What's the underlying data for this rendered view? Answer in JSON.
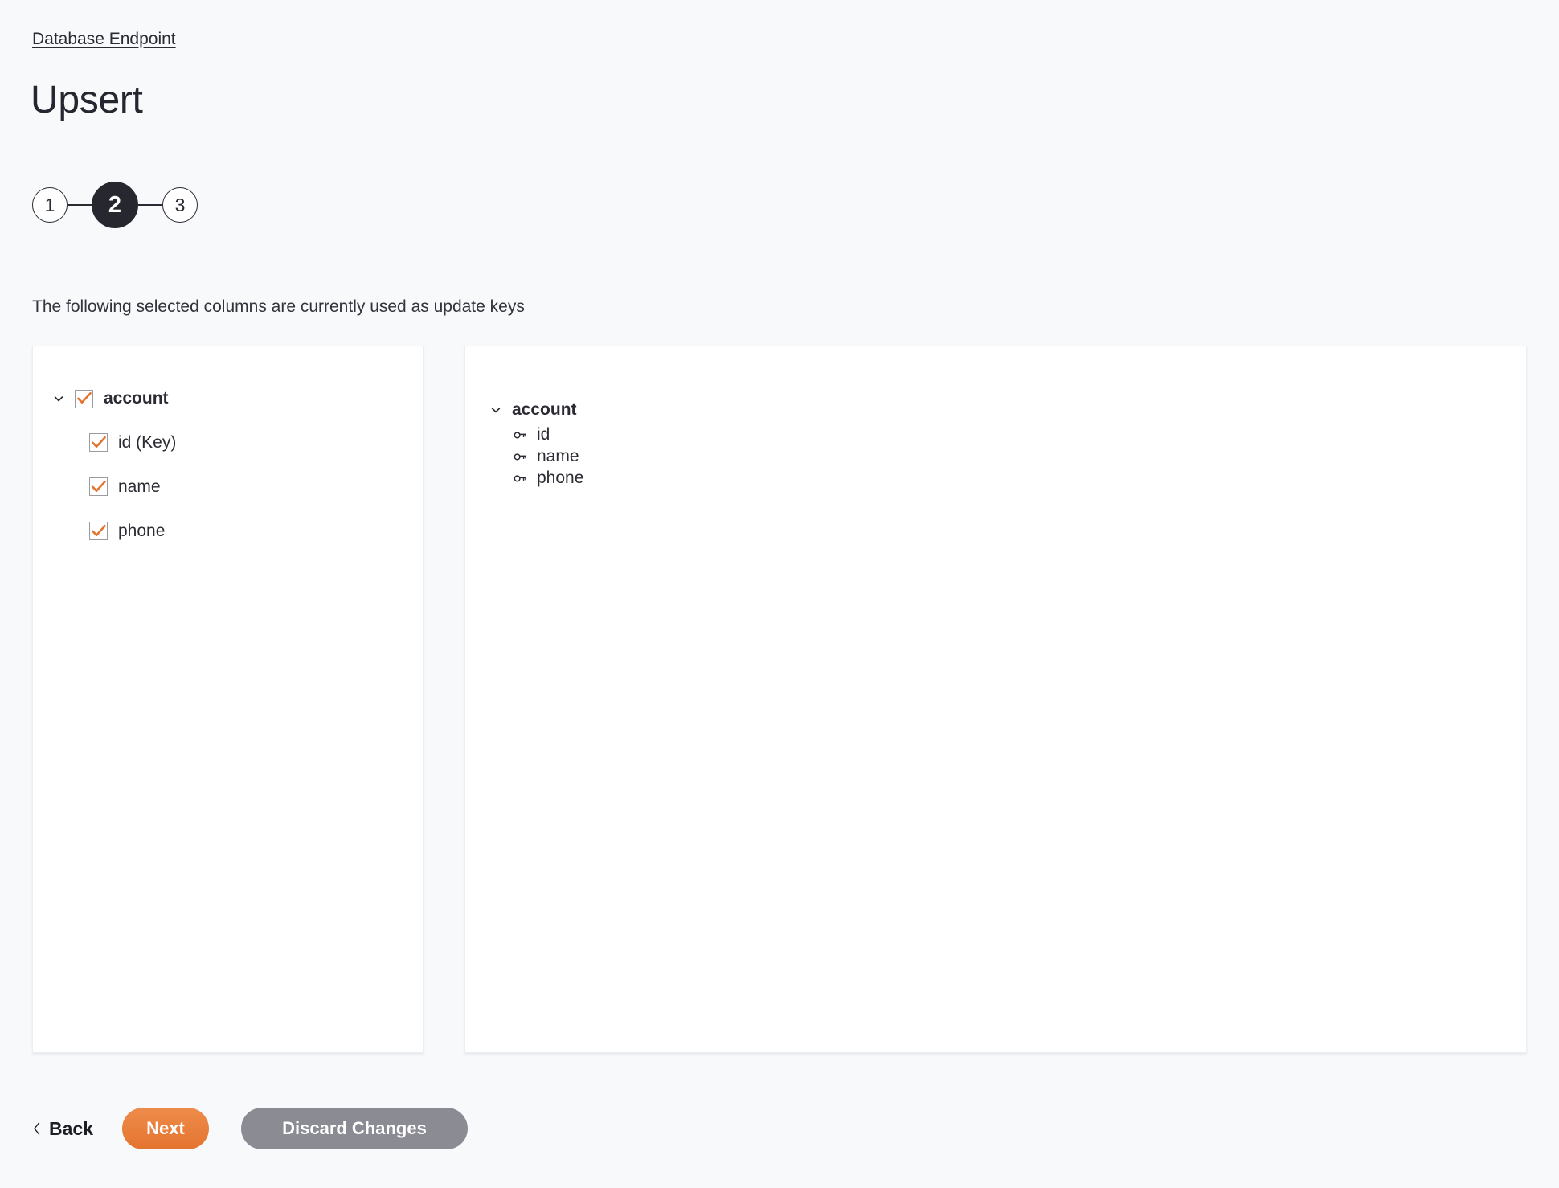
{
  "header": {
    "breadcrumb": "Database Endpoint",
    "title": "Upsert"
  },
  "stepper": {
    "steps": [
      {
        "label": "1",
        "active": false
      },
      {
        "label": "2",
        "active": true
      },
      {
        "label": "3",
        "active": false
      }
    ]
  },
  "description": "The following selected columns are currently used as update keys",
  "left_panel": {
    "root": {
      "label": "account",
      "checked": true,
      "expanded": true
    },
    "children": [
      {
        "label": "id (Key)",
        "checked": true
      },
      {
        "label": "name",
        "checked": true
      },
      {
        "label": "phone",
        "checked": true
      }
    ]
  },
  "right_panel": {
    "root": {
      "label": "account",
      "expanded": true
    },
    "children": [
      {
        "label": "id",
        "icon": "key-icon"
      },
      {
        "label": "name",
        "icon": "key-icon"
      },
      {
        "label": "phone",
        "icon": "key-icon"
      }
    ]
  },
  "footer": {
    "back_label": "Back",
    "next_label": "Next",
    "discard_label": "Discard Changes"
  },
  "colors": {
    "background": "#f8f9fb",
    "accent_orange": "#e4742f",
    "check_orange": "#e2742f",
    "active_step": "#27272f",
    "discard_gray": "#8b8b93",
    "panel_white": "#ffffff"
  }
}
